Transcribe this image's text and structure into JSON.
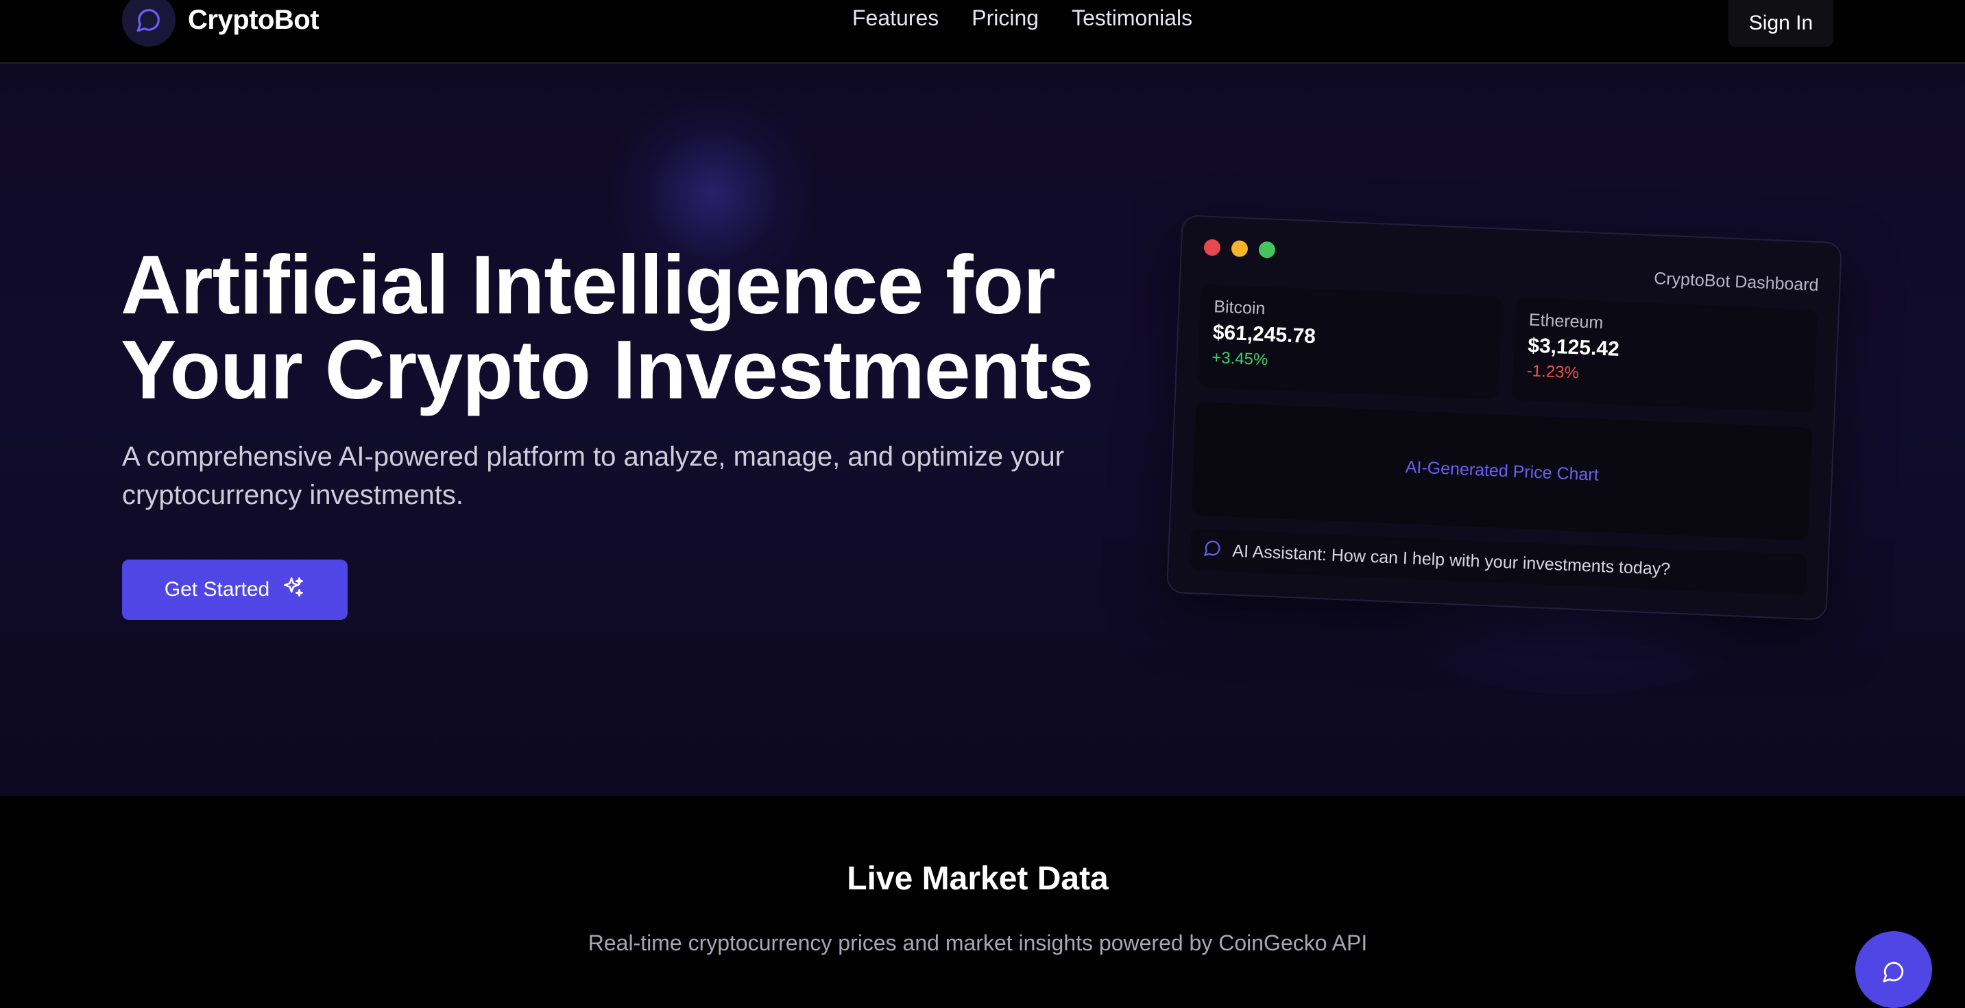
{
  "header": {
    "brand": "CryptoBot",
    "nav": [
      "Features",
      "Pricing",
      "Testimonials"
    ],
    "signin_label": "Sign In"
  },
  "hero": {
    "headline_line1": "Artificial Intelligence for",
    "headline_line2": "Your Crypto Investments",
    "subtext": "A comprehensive AI-powered platform to analyze, manage, and optimize your cryptocurrency investments.",
    "cta_label": "Get Started"
  },
  "dashboard": {
    "title": "CryptoBot Dashboard",
    "coins": [
      {
        "name": "Bitcoin",
        "price": "$61,245.78",
        "change": "+3.45%"
      },
      {
        "name": "Ethereum",
        "price": "$3,125.42",
        "change": "-1.23%"
      }
    ],
    "chart_label": "AI-Generated Price Chart",
    "assistant_text": "AI Assistant: How can I help with your investments today?"
  },
  "market": {
    "title": "Live Market Data",
    "subtitle": "Real-time cryptocurrency prices and market insights powered by CoinGecko API"
  },
  "colors": {
    "accent": "#4f46e5",
    "positive": "#3fce6a",
    "negative": "#ef4d4d"
  },
  "icons": {
    "logo": "chat-bubble-icon",
    "cta": "sparkles-icon",
    "assistant": "chat-bubble-icon",
    "fab": "chat-bubble-icon"
  }
}
